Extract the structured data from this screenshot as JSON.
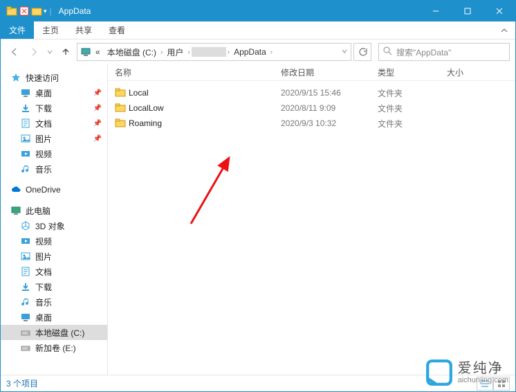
{
  "titlebar": {
    "title": "AppData"
  },
  "ribbon": {
    "file": "文件",
    "tabs": [
      "主页",
      "共享",
      "查看"
    ]
  },
  "address": {
    "root_icon": "pc",
    "crumbs": [
      "«",
      "本地磁盘 (C:)",
      "用户",
      "",
      "AppData"
    ],
    "redacted_index": 3
  },
  "search": {
    "placeholder": "搜索\"AppData\""
  },
  "columns": {
    "name": "名称",
    "date": "修改日期",
    "type": "类型",
    "size": "大小"
  },
  "rows": [
    {
      "name": "Local",
      "date": "2020/9/15 15:46",
      "type": "文件夹"
    },
    {
      "name": "LocalLow",
      "date": "2020/8/11 9:09",
      "type": "文件夹"
    },
    {
      "name": "Roaming",
      "date": "2020/9/3 10:32",
      "type": "文件夹"
    }
  ],
  "sidebar": {
    "quick": {
      "label": "快速访问",
      "items": [
        {
          "label": "桌面",
          "icon": "desktop",
          "pin": true
        },
        {
          "label": "下载",
          "icon": "download",
          "pin": true
        },
        {
          "label": "文档",
          "icon": "doc",
          "pin": true
        },
        {
          "label": "图片",
          "icon": "pic",
          "pin": true
        },
        {
          "label": "视频",
          "icon": "video",
          "pin": false
        },
        {
          "label": "音乐",
          "icon": "music",
          "pin": false
        }
      ]
    },
    "onedrive": {
      "label": "OneDrive"
    },
    "thispc": {
      "label": "此电脑",
      "items": [
        {
          "label": "3D 对象",
          "icon": "3d"
        },
        {
          "label": "视频",
          "icon": "video"
        },
        {
          "label": "图片",
          "icon": "pic"
        },
        {
          "label": "文档",
          "icon": "doc"
        },
        {
          "label": "下载",
          "icon": "download"
        },
        {
          "label": "音乐",
          "icon": "music"
        },
        {
          "label": "桌面",
          "icon": "desktop"
        },
        {
          "label": "本地磁盘 (C:)",
          "icon": "drive",
          "active": true
        },
        {
          "label": "新加卷 (E:)",
          "icon": "drive"
        }
      ]
    }
  },
  "status": {
    "text": "3 个项目"
  },
  "watermark": {
    "main": "爱纯净",
    "sub": "aichunjing.com"
  }
}
